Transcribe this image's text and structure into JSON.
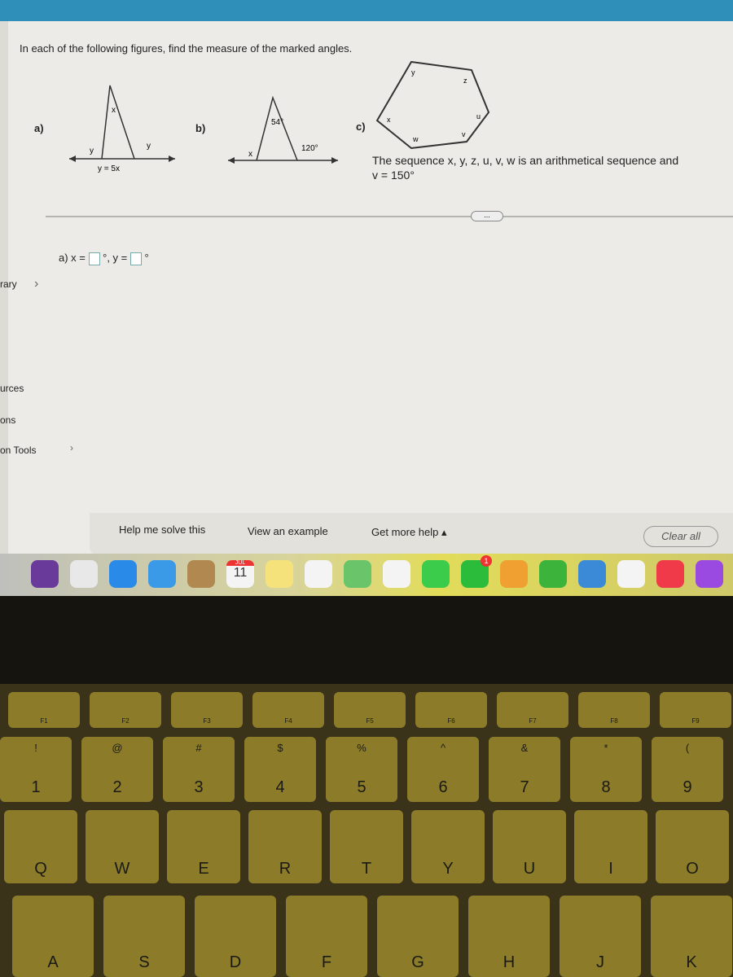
{
  "sidebar": {
    "items": [
      {
        "label": "rary"
      },
      {
        "label": "urces"
      },
      {
        "label": "ons"
      },
      {
        "label": "on Tools"
      }
    ]
  },
  "question": {
    "instruction": "In each of the following figures, find the measure of the marked angles.",
    "figures": [
      {
        "label": "a)",
        "marks": [
          "x",
          "y",
          "y",
          "y = 5x"
        ]
      },
      {
        "label": "b)",
        "marks": [
          "54°",
          "x",
          "120°"
        ]
      },
      {
        "label": "c)",
        "marks": [
          "x",
          "y",
          "z",
          "u",
          "v",
          "w"
        ]
      }
    ],
    "sequence_text": "The sequence x, y, z, u, v, w is an arithmetical sequence and",
    "given": "v = 150°",
    "more": "...",
    "answer": {
      "label": "a) x =",
      "sep": "°, y =",
      "unit": "°",
      "x_value": "",
      "y_value": ""
    }
  },
  "footer": {
    "help": "Help me solve this",
    "example": "View an example",
    "more_help": "Get more help ▴",
    "clear": "Clear all"
  },
  "dock": {
    "apps": [
      {
        "name": "siri",
        "color": "#6a3a9a"
      },
      {
        "name": "launchpad",
        "color": "#e8e8e8"
      },
      {
        "name": "safari",
        "color": "#2a8ae8"
      },
      {
        "name": "mail",
        "color": "#3a9ae8"
      },
      {
        "name": "contacts",
        "color": "#b08850"
      },
      {
        "name": "calendar",
        "color": "#f4f4f4",
        "month": "JUL",
        "day": "11"
      },
      {
        "name": "notes",
        "color": "#f6e27a"
      },
      {
        "name": "reminders",
        "color": "#f4f4f4"
      },
      {
        "name": "maps",
        "color": "#6ac46a"
      },
      {
        "name": "photos",
        "color": "#f4f4f4"
      },
      {
        "name": "messages",
        "color": "#3ccc4c"
      },
      {
        "name": "facetime",
        "color": "#2cbc3c",
        "badge": "1"
      },
      {
        "name": "pages",
        "color": "#f0a030"
      },
      {
        "name": "numbers",
        "color": "#3cb43c"
      },
      {
        "name": "keynote",
        "color": "#3a8ad8"
      },
      {
        "name": "news",
        "color": "#f4f4f4"
      },
      {
        "name": "music",
        "color": "#f03a4a"
      },
      {
        "name": "podcasts",
        "color": "#9a4ae0"
      }
    ]
  },
  "keyboard": {
    "fkeys": [
      "F1",
      "F2",
      "F3",
      "F4",
      "F5",
      "F6",
      "F7",
      "F8",
      "F9"
    ],
    "numbers": [
      {
        "t": "!",
        "b": "1"
      },
      {
        "t": "@",
        "b": "2"
      },
      {
        "t": "#",
        "b": "3"
      },
      {
        "t": "$",
        "b": "4"
      },
      {
        "t": "%",
        "b": "5"
      },
      {
        "t": "^",
        "b": "6"
      },
      {
        "t": "&",
        "b": "7"
      },
      {
        "t": "*",
        "b": "8"
      },
      {
        "t": "(",
        "b": "9"
      }
    ],
    "row1": [
      "Q",
      "W",
      "E",
      "R",
      "T",
      "Y",
      "U",
      "I",
      "O"
    ],
    "row2": [
      "A",
      "S",
      "D",
      "F",
      "G",
      "H",
      "J",
      "K"
    ]
  }
}
